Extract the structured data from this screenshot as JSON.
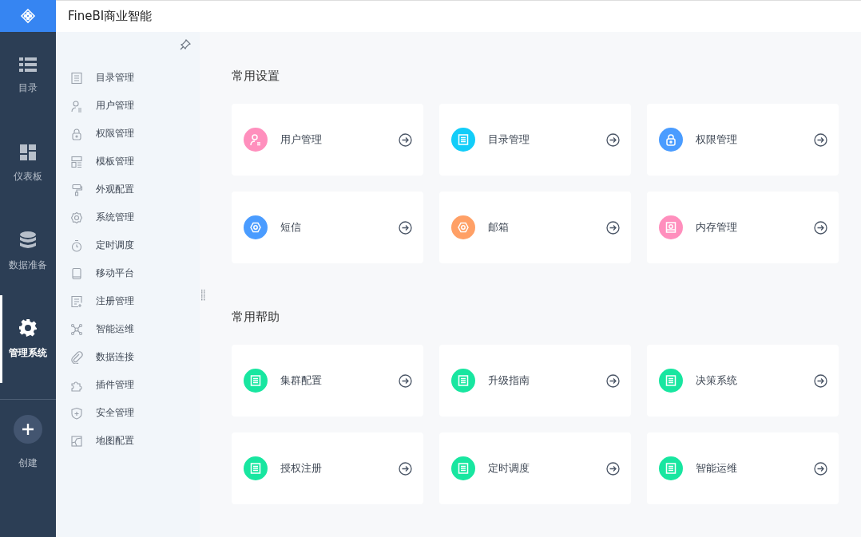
{
  "header": {
    "title": "FineBI商业智能"
  },
  "nav": [
    {
      "label": "目录",
      "selected": false
    },
    {
      "label": "仪表板",
      "selected": false
    },
    {
      "label": "数据准备",
      "selected": false
    },
    {
      "label": "管理系统",
      "selected": true
    }
  ],
  "create": {
    "label": "创建"
  },
  "sidebar": {
    "items": [
      {
        "label": "目录管理"
      },
      {
        "label": "用户管理"
      },
      {
        "label": "权限管理"
      },
      {
        "label": "模板管理"
      },
      {
        "label": "外观配置"
      },
      {
        "label": "系统管理"
      },
      {
        "label": "定时调度"
      },
      {
        "label": "移动平台"
      },
      {
        "label": "注册管理"
      },
      {
        "label": "智能运维"
      },
      {
        "label": "数据连接"
      },
      {
        "label": "插件管理"
      },
      {
        "label": "安全管理"
      },
      {
        "label": "地图配置"
      }
    ]
  },
  "sections": [
    {
      "title": "常用设置",
      "cards": [
        {
          "label": "用户管理",
          "color": "#ff8fbd"
        },
        {
          "label": "目录管理",
          "color": "#12cdf9"
        },
        {
          "label": "权限管理",
          "color": "#4a9cff"
        },
        {
          "label": "短信",
          "color": "#4a9cff"
        },
        {
          "label": "邮箱",
          "color": "#ffa066"
        },
        {
          "label": "内存管理",
          "color": "#ff8fbd"
        }
      ]
    },
    {
      "title": "常用帮助",
      "cards": [
        {
          "label": "集群配置",
          "color": "#18e6a0"
        },
        {
          "label": "升级指南",
          "color": "#18e6a0"
        },
        {
          "label": "决策系统",
          "color": "#18e6a0"
        },
        {
          "label": "授权注册",
          "color": "#18e6a0"
        },
        {
          "label": "定时调度",
          "color": "#18e6a0"
        },
        {
          "label": "智能运维",
          "color": "#18e6a0"
        }
      ]
    }
  ]
}
